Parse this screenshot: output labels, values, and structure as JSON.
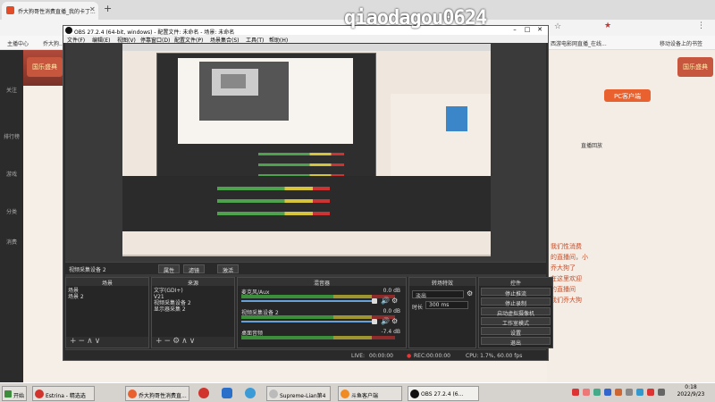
{
  "watermark": "qiaodagou0624",
  "browser": {
    "tab_title": "乔大狗哥性消费直播_我的卡丁...",
    "bookmarks": [
      "主播中心",
      "乔大狗..."
    ],
    "bookmark_right": "移动设备上的书签",
    "bookmark_mid": "西游电影网直播_在线..."
  },
  "page": {
    "festival_banner": "国乐盛典",
    "pc_client": "PC客户端",
    "rail_items": [
      "关注",
      "排行榜",
      "游戏",
      "分类",
      "消费"
    ],
    "stats": "直播回放",
    "orange_text": "我们性消费\n的直播间，小\n乔大狗了\n在这里欢迎\n的直播间\n我们乔大狗"
  },
  "obs": {
    "title": "OBS 27.2.4 (64-bit, windows) - 配置文件: 未命名 - 场景: 未命名",
    "menu": [
      "文件(F)",
      "编辑(E)",
      "视图(V)",
      "停靠窗口(D)",
      "配置文件(P)",
      "场景集合(S)",
      "工具(T)",
      "帮助(H)"
    ],
    "source_label": "视频采集设备 2",
    "source_buttons": [
      "属性",
      "滤镜",
      "激活"
    ],
    "scenes": {
      "header": "场景",
      "items": [
        "场景",
        "场景 2"
      ]
    },
    "sources": {
      "header": "来源",
      "items": [
        "文字(GDI+)",
        "V21",
        "视频采集设备 2",
        "显示器采集 2"
      ]
    },
    "mixer": {
      "header": "混音器",
      "tracks": [
        {
          "name": "麦克风/Aux",
          "db": "0.0 dB"
        },
        {
          "name": "视频采集设备 2",
          "db": "0.0 dB"
        },
        {
          "name": "桌面音频",
          "db": "-7.4 dB"
        }
      ]
    },
    "transitions": {
      "header": "转场特效",
      "type": "淡出",
      "duration_label": "时长",
      "duration": "300 ms"
    },
    "controls": {
      "header": "控件",
      "buttons": [
        "停止推流",
        "停止录制",
        "启动虚拟摄像机",
        "工作室模式",
        "设置",
        "退出"
      ]
    },
    "status": {
      "live_label": "LIVE:",
      "live_time": "00:00:00",
      "rec_label": "REC:",
      "rec_time": "00:00:00",
      "cpu": "CPU: 1.7%, 60.00 fps"
    }
  },
  "taskbar": {
    "start": "开始",
    "tasks": [
      "Estrina - 精选选",
      "乔大狗哥性消费直...",
      "Supreme-Lian第4",
      "斗鱼客户端",
      "OBS 27.2.4 (6..."
    ],
    "clock_time": "0:18",
    "clock_date": "2022/9/23"
  }
}
